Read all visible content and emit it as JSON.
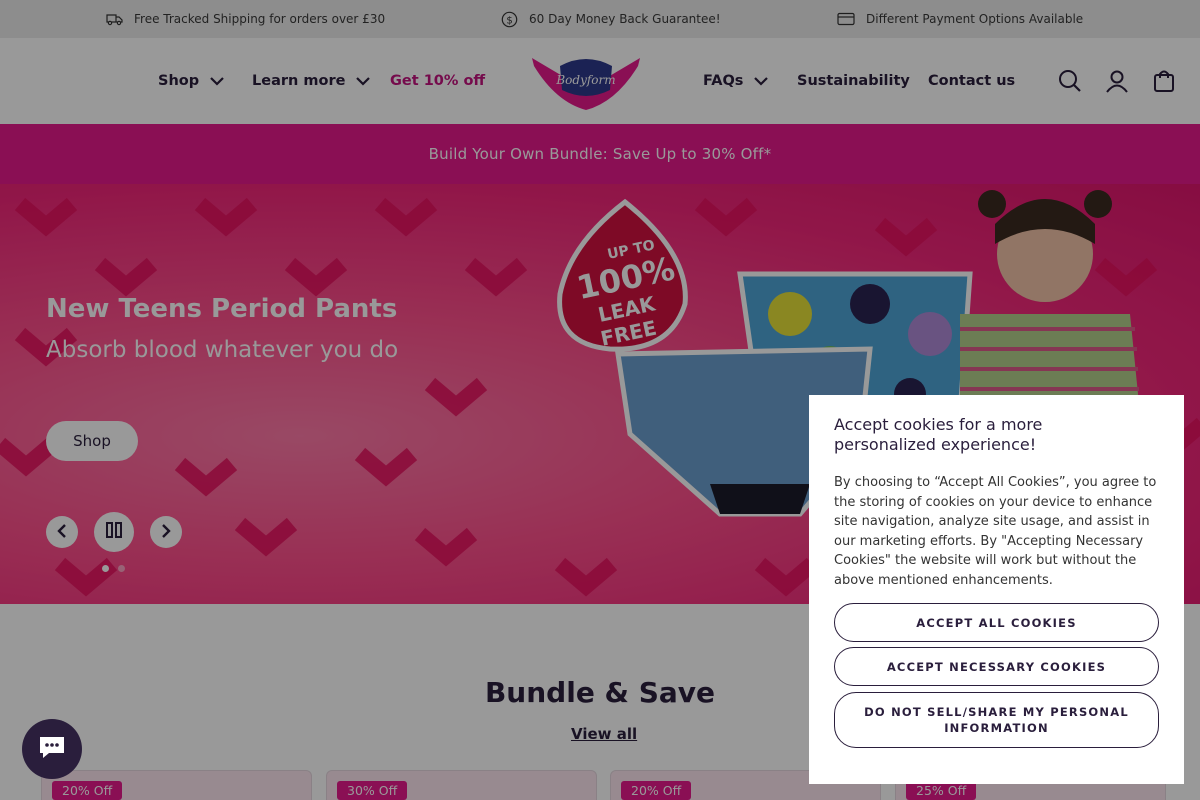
{
  "topbar": {
    "usp1": "Free Tracked Shipping for orders over £30",
    "usp2": "60 Day Money Back Guarantee!",
    "usp3": "Different Payment Options Available",
    "icons": [
      "truck-icon",
      "money-icon",
      "card-icon"
    ]
  },
  "nav": {
    "shop": "Shop",
    "learn": "Learn more",
    "get": "Get 10% off",
    "faqs": "FAQs",
    "sustainability": "Sustainability",
    "contact": "Contact us"
  },
  "logo": {
    "text": "Bodyform"
  },
  "promo": {
    "text": "Build Your Own Bundle: Save Up to 30% Off*"
  },
  "hero": {
    "title": "New Teens Period Pants",
    "subtitle": "Absorb blood whatever you do",
    "shop_label": "Shop",
    "art": {
      "l1": "UP TO",
      "l2": "100%",
      "l3": "LEAK",
      "l4": "FREE"
    },
    "slide_count": 2,
    "active_slide": 1
  },
  "bundle": {
    "title": "Bundle & Save",
    "view_all": "View all",
    "cards": [
      {
        "badge": "20% Off"
      },
      {
        "badge": "30% Off"
      },
      {
        "badge": "20% Off"
      },
      {
        "badge": "25% Off"
      }
    ]
  },
  "cookie": {
    "title": "Accept cookies for a more personalized experience!",
    "text": "By choosing to “Accept All Cookies”, you agree to the storing of cookies on your device to enhance site navigation, analyze site usage, and assist in our marketing efforts. By \"Accepting Necessary Cookies\" the website will work but without the above mentioned enhancements.",
    "accept_all": "ACCEPT ALL COOKIES",
    "accept_necessary": "ACCEPT NECESSARY COOKIES",
    "do_not_sell": "DO NOT SELL/SHARE MY PERSONAL INFORMATION"
  },
  "colors": {
    "brand_pink": "#e61a8d",
    "navy": "#2a1e3c",
    "accent_link": "#c4137f"
  }
}
